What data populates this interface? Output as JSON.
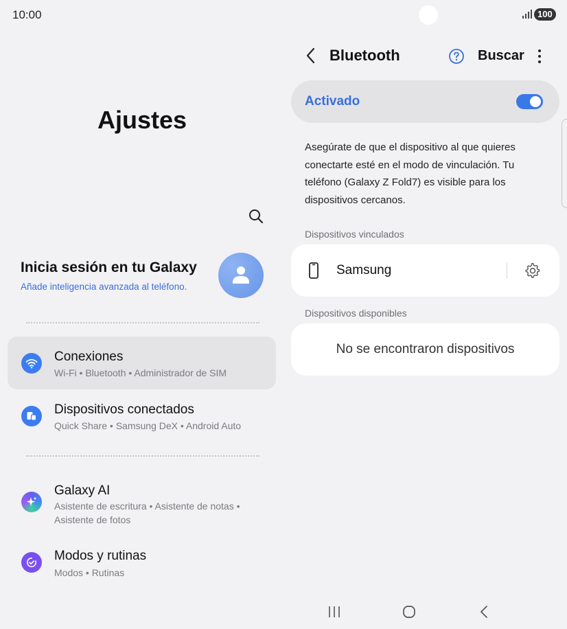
{
  "status_bar": {
    "time": "10:00",
    "battery": "100"
  },
  "left": {
    "title": "Ajustes",
    "account": {
      "title": "Inicia sesión en tu Galaxy",
      "subtitle": "Añade inteligencia avanzada al teléfono."
    },
    "items": [
      {
        "title": "Conexiones",
        "subtitle": "Wi-Fi  •  Bluetooth  •  Administrador de SIM"
      },
      {
        "title": "Dispositivos conectados",
        "subtitle": "Quick Share  •  Samsung DeX  •  Android Auto"
      },
      {
        "title": "Galaxy AI",
        "subtitle": "Asistente de escritura  •  Asistente de notas  •  Asistente de fotos"
      },
      {
        "title": "Modos y rutinas",
        "subtitle": "Modos  •  Rutinas"
      }
    ]
  },
  "right": {
    "title": "Bluetooth",
    "search_label": "Buscar",
    "toggle": {
      "label": "Activado",
      "on": true
    },
    "description": "Asegúrate de que el dispositivo al que quieres conectarte esté en el modo de vinculación. Tu teléfono (Galaxy Z Fold7) es visible para los dispositivos cercanos.",
    "paired_section": "Dispositivos vinculados",
    "paired_devices": [
      {
        "name": "Samsung"
      }
    ],
    "available_section": "Dispositivos disponibles",
    "no_devices": "No se encontraron dispositivos"
  },
  "colors": {
    "accent": "#3a6fd8",
    "switch_on": "#3a78e6",
    "background": "#f2f2f4",
    "card": "#ffffff"
  },
  "icons": {
    "search": "search-icon",
    "back": "chevron-left-icon",
    "help": "help-circle-icon",
    "more": "more-vertical-icon",
    "device": "smartphone-icon",
    "settings": "gear-icon"
  }
}
